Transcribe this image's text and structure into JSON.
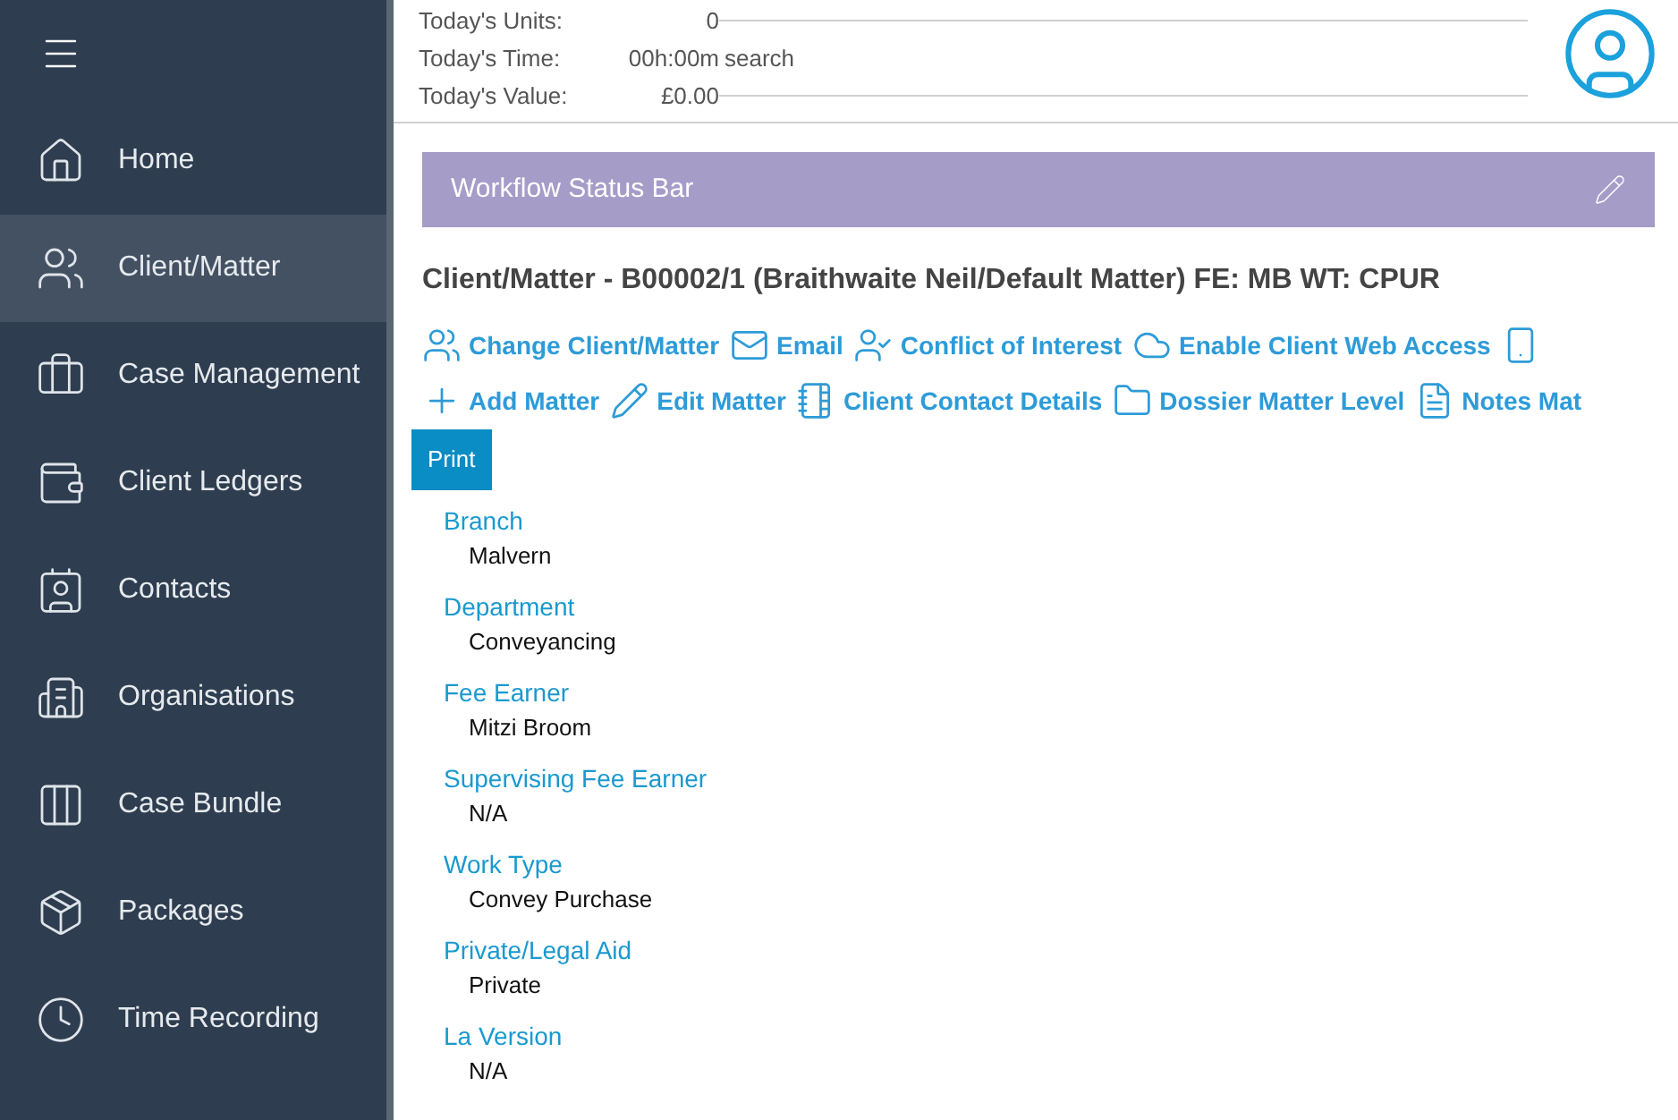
{
  "sidebar": {
    "items": [
      {
        "label": "Home",
        "selected": false
      },
      {
        "label": "Client/Matter",
        "selected": true
      },
      {
        "label": "Case Management",
        "selected": false
      },
      {
        "label": "Client Ledgers",
        "selected": false
      },
      {
        "label": "Contacts",
        "selected": false
      },
      {
        "label": "Organisations",
        "selected": false
      },
      {
        "label": "Case Bundle",
        "selected": false
      },
      {
        "label": "Packages",
        "selected": false
      },
      {
        "label": "Time Recording",
        "selected": false
      }
    ]
  },
  "stats": [
    {
      "label": "Today's Units:",
      "value": "0"
    },
    {
      "label": "Today's Time:",
      "value": "00h:00m",
      "note": "search"
    },
    {
      "label": "Today's Value:",
      "value": "£0.00"
    }
  ],
  "workflow_bar": {
    "title": "Workflow Status Bar"
  },
  "heading": "Client/Matter - B00002/1 (Braithwaite  Neil/Default Matter) FE: MB WT: CPUR",
  "actions": [
    [
      {
        "kind": "labeled",
        "label": "Change Client/Matter"
      },
      {
        "kind": "labeled",
        "label": "Email"
      },
      {
        "kind": "labeled",
        "label": "Conflict of Interest"
      },
      {
        "kind": "labeled",
        "label": "Enable Client Web Access"
      },
      {
        "kind": "icon_only"
      }
    ],
    [
      {
        "kind": "labeled",
        "label": "Add Matter"
      },
      {
        "kind": "labeled",
        "label": "Edit Matter"
      },
      {
        "kind": "labeled",
        "label": "Client Contact Details"
      },
      {
        "kind": "labeled",
        "label": "Dossier Matter Level"
      },
      {
        "kind": "labeled",
        "label": "Notes Mat"
      }
    ]
  ],
  "print_button": "Print",
  "fields": [
    {
      "label": "Branch",
      "value": "Malvern"
    },
    {
      "label": "Department",
      "value": "Conveyancing"
    },
    {
      "label": "Fee Earner",
      "value": "Mitzi Broom"
    },
    {
      "label": "Supervising Fee Earner",
      "value": "N/A"
    },
    {
      "label": "Work Type",
      "value": "Convey Purchase"
    },
    {
      "label": "Private/Legal Aid",
      "value": "Private"
    },
    {
      "label": "La Version",
      "value": "N/A"
    }
  ]
}
